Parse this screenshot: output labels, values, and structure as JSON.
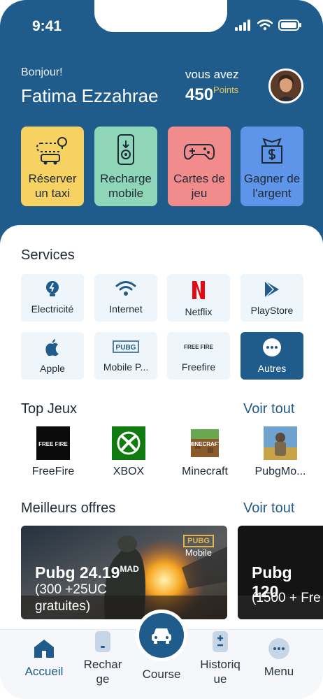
{
  "status": {
    "time": "9:41"
  },
  "header": {
    "greeting": "Bonjour!",
    "user_name": "Fatima Ezzahrae",
    "points_label": "vous avez",
    "points_value": "450",
    "points_unit": "Points"
  },
  "quick_actions": [
    {
      "label": "Réserver un taxi",
      "icon": "taxi-route-icon",
      "color": "#f6d262"
    },
    {
      "label": "Recharge mobile",
      "icon": "mobile-recharge-icon",
      "color": "#8fd5b8"
    },
    {
      "label": "Cartes de jeu",
      "icon": "gamepad-icon",
      "color": "#f28b8b"
    },
    {
      "label": "Gagner de l'argent",
      "icon": "money-bag-icon",
      "color": "#5e95e8"
    }
  ],
  "services": {
    "title": "Services",
    "items": [
      {
        "label": "Electricité",
        "icon": "lightbulb-icon"
      },
      {
        "label": "Internet",
        "icon": "wifi-icon"
      },
      {
        "label": "Netflix",
        "icon": "netflix-logo-icon"
      },
      {
        "label": "PlayStore",
        "icon": "playstore-icon"
      },
      {
        "label": "Apple",
        "icon": "apple-logo-icon"
      },
      {
        "label": "Mobile P...",
        "icon": "pubg-logo-icon",
        "logo_text": "PUBG"
      },
      {
        "label": "Freefire",
        "icon": "freefire-logo-icon",
        "logo_text": "FREE FIRE"
      },
      {
        "label": "Autres",
        "icon": "more-dots-icon"
      }
    ]
  },
  "top_games": {
    "title": "Top Jeux",
    "see_all": "Voir tout",
    "items": [
      {
        "label": "FreeFire",
        "logo_text": "FREE FIRE"
      },
      {
        "label": "XBOX"
      },
      {
        "label": "Minecraft",
        "logo_text": "MINECRAFT"
      },
      {
        "label": "PubgMo..."
      }
    ]
  },
  "offers": {
    "title": "Meilleurs offres",
    "see_all": "Voir tout",
    "items": [
      {
        "title": "Pubg 24.19",
        "unit": "MAD",
        "subtitle": "(300 +25UC gratuites)",
        "badge_logo": "PUBG",
        "badge_text": "Mobile"
      },
      {
        "title": "Pubg 120",
        "subtitle": "(1500 + Fre"
      }
    ]
  },
  "tabbar": {
    "items": [
      {
        "label": "Accueil",
        "icon": "home-icon",
        "active": true
      },
      {
        "label": "Recharge",
        "icon": "phone-icon"
      },
      {
        "label": "Course",
        "icon": "car-icon"
      },
      {
        "label": "Historique",
        "icon": "receipt-icon"
      },
      {
        "label": "Menu",
        "icon": "menu-dots-icon"
      }
    ]
  },
  "colors": {
    "primary": "#1f5c8b",
    "points_accent": "#e8c54a"
  }
}
